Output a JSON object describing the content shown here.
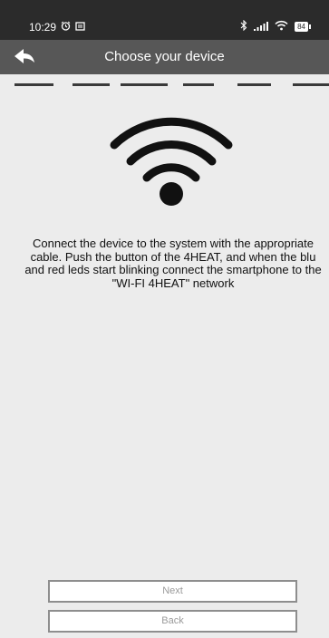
{
  "status_bar": {
    "time": "10:29",
    "battery_level": "84",
    "icons": [
      "alarm-icon",
      "notification-icon",
      "bluetooth-icon",
      "signal-icon",
      "wifi-status-icon",
      "battery-icon"
    ]
  },
  "header": {
    "title": "Choose your device",
    "back_icon": "back-arrow-icon"
  },
  "progress": {
    "total_steps": 6
  },
  "main": {
    "icon": "wifi-icon",
    "instruction": "Connect the device to the system with the appropriate cable. Push the button of the 4HEAT, and when the blu and red leds start blinking connect the smartphone to the \"WI-FI 4HEAT\" network"
  },
  "buttons": {
    "next_label": "Next",
    "back_label": "Back"
  },
  "colors": {
    "status_bar": "#2b2b2b",
    "header": "#575757",
    "background": "#ececec",
    "button_border": "#8e8e8e",
    "button_text": "#9a9a9a"
  }
}
